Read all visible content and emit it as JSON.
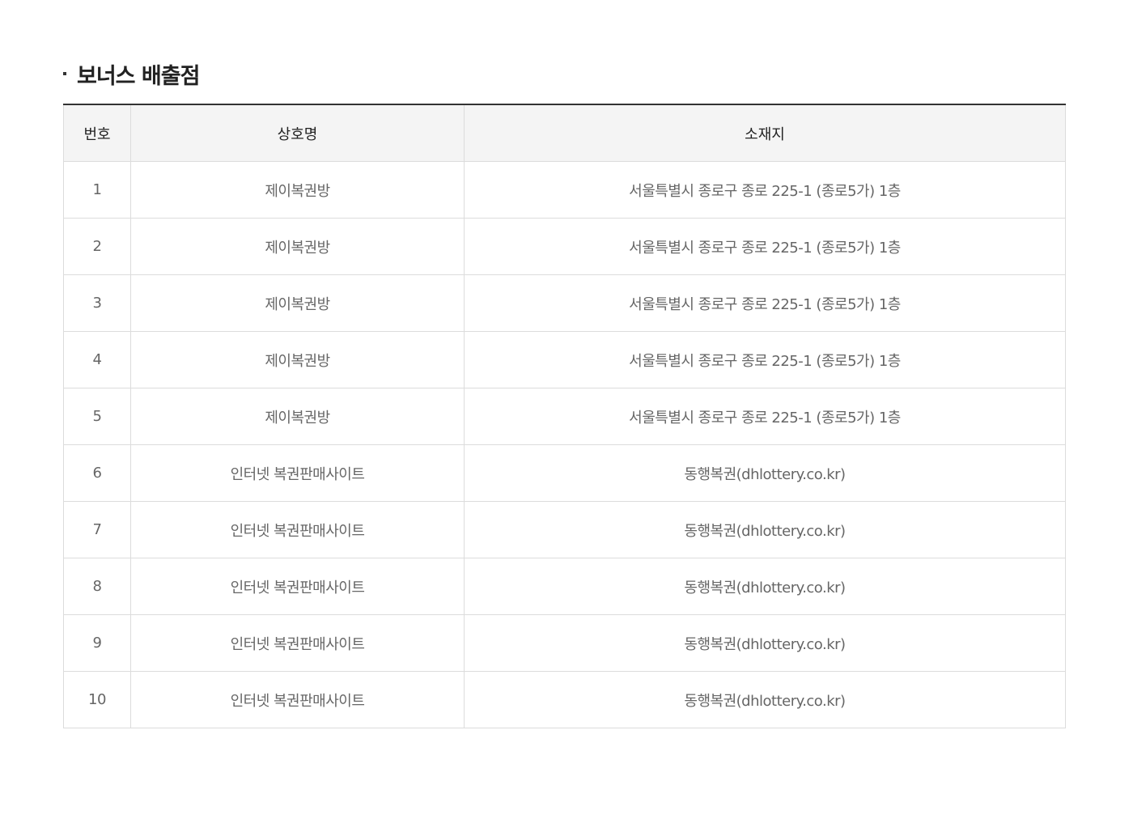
{
  "section": {
    "title": "보너스 배출점"
  },
  "table": {
    "headers": {
      "number": "번호",
      "name": "상호명",
      "address": "소재지"
    },
    "rows": [
      {
        "number": "1",
        "name": "제이복권방",
        "address": "서울특별시 종로구 종로 225-1 (종로5가) 1층"
      },
      {
        "number": "2",
        "name": "제이복권방",
        "address": "서울특별시 종로구 종로 225-1 (종로5가) 1층"
      },
      {
        "number": "3",
        "name": "제이복권방",
        "address": "서울특별시 종로구 종로 225-1 (종로5가) 1층"
      },
      {
        "number": "4",
        "name": "제이복권방",
        "address": "서울특별시 종로구 종로 225-1 (종로5가) 1층"
      },
      {
        "number": "5",
        "name": "제이복권방",
        "address": "서울특별시 종로구 종로 225-1 (종로5가) 1층"
      },
      {
        "number": "6",
        "name": "인터넷 복권판매사이트",
        "address": "동행복권(dhlottery.co.kr)"
      },
      {
        "number": "7",
        "name": "인터넷 복권판매사이트",
        "address": "동행복권(dhlottery.co.kr)"
      },
      {
        "number": "8",
        "name": "인터넷 복권판매사이트",
        "address": "동행복권(dhlottery.co.kr)"
      },
      {
        "number": "9",
        "name": "인터넷 복권판매사이트",
        "address": "동행복권(dhlottery.co.kr)"
      },
      {
        "number": "10",
        "name": "인터넷 복권판매사이트",
        "address": "동행복권(dhlottery.co.kr)"
      }
    ]
  }
}
